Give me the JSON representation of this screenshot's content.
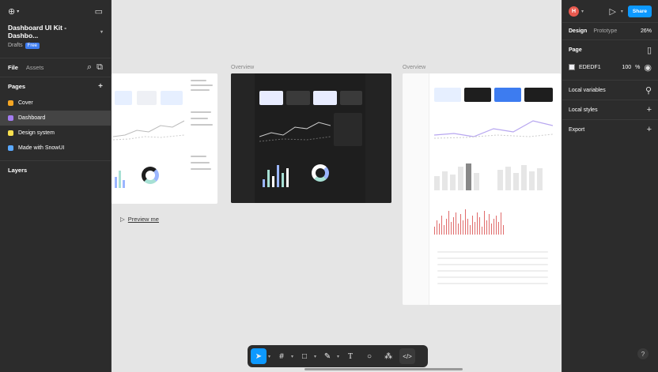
{
  "left_panel": {
    "file_name": "Dashboard UI Kit - Dashbo...",
    "drafts_label": "Drafts",
    "plan_badge": "Free",
    "tab_file": "File",
    "tab_assets": "Assets",
    "pages_heading": "Pages",
    "pages": [
      {
        "label": "Cover",
        "swatch": "#f5a623"
      },
      {
        "label": "Dashboard",
        "swatch": "#a37cf0",
        "selected": true
      },
      {
        "label": "Design system",
        "swatch": "#f8e04e"
      },
      {
        "label": "Made with SnowUI",
        "swatch": "#5aa9ff"
      }
    ],
    "layers_heading": "Layers"
  },
  "canvas": {
    "overview_label_1": "Overview",
    "overview_label_2": "Overview",
    "preview_link": "Preview me",
    "background": "#e5e5e5"
  },
  "right_panel": {
    "avatar_letter": "H",
    "share_label": "Share",
    "tab_design": "Design",
    "tab_prototype": "Prototype",
    "zoom": "26%",
    "page_heading": "Page",
    "page_fill_hex": "EDEDF1",
    "page_fill_opacity": "100",
    "page_fill_unit": "%",
    "local_variables": "Local variables",
    "local_styles": "Local styles",
    "export": "Export"
  },
  "toolbar": {
    "selected_tool": "move",
    "tools": [
      "move-icon",
      "frame-icon",
      "shape-icon",
      "pen-icon",
      "text-icon",
      "comment-icon",
      "actions-icon",
      "dev-mode-icon"
    ]
  },
  "colors": {
    "accent": "#0d99ff",
    "panel": "#2c2c2c"
  }
}
